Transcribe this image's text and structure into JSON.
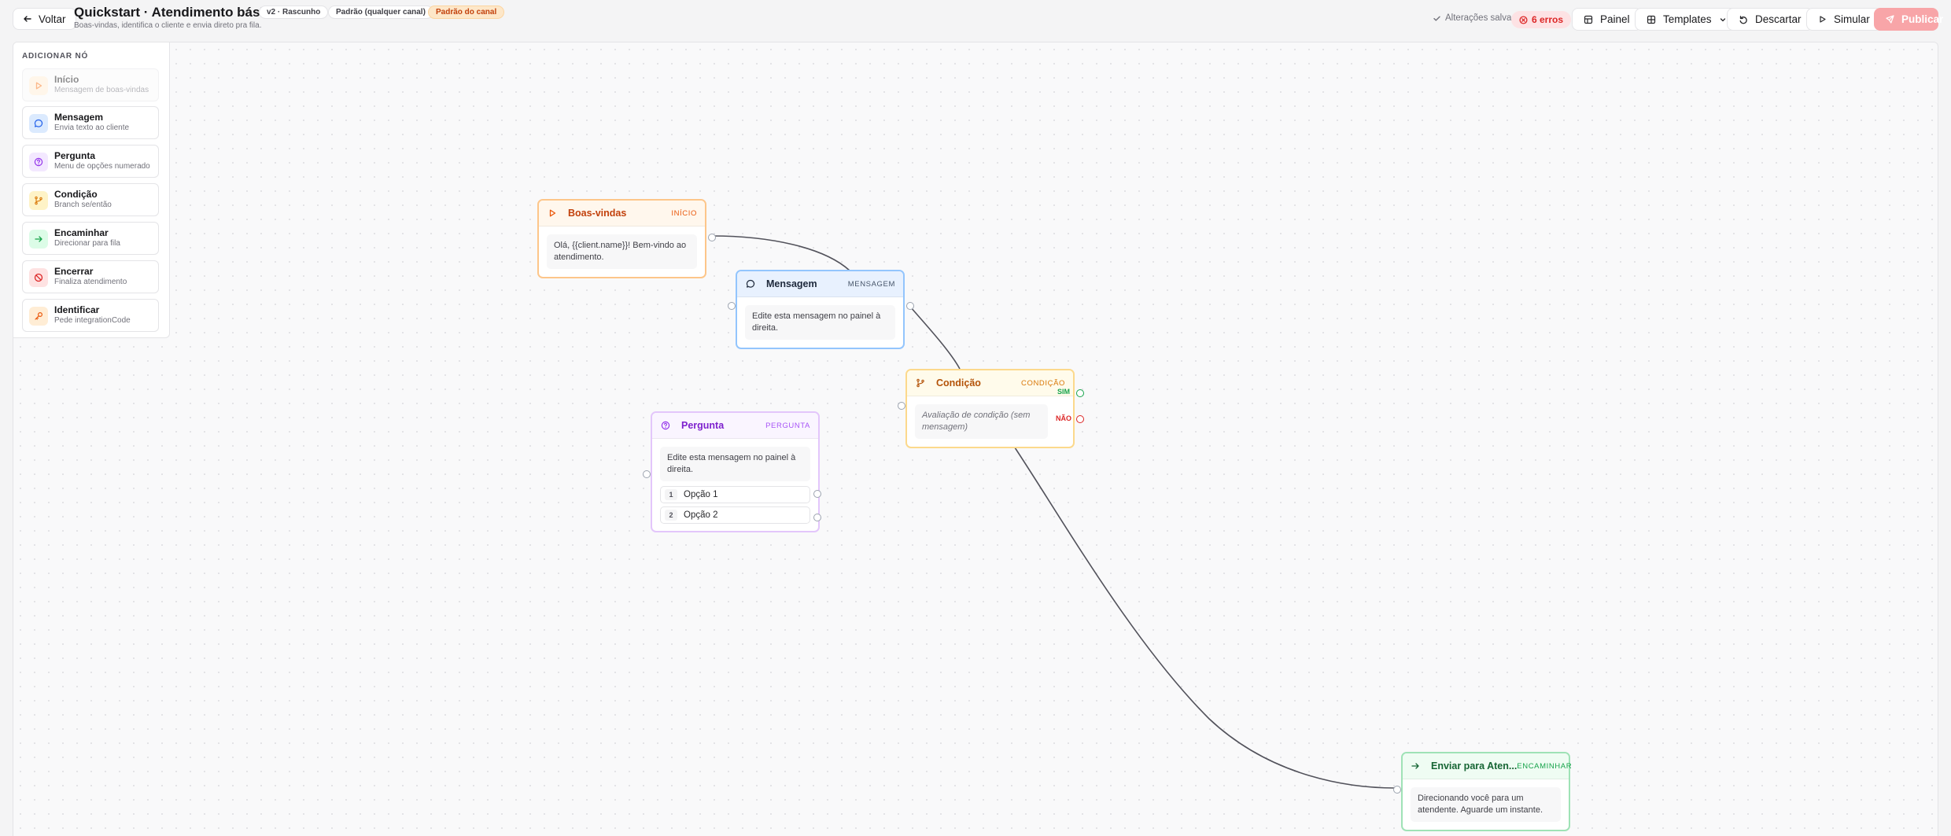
{
  "header": {
    "back_label": "Voltar",
    "title": "Quickstart · Atendimento básico",
    "subtitle": "Boas-vindas, identifica o cliente e envia direto pra fila.",
    "chips": [
      "v2 · Rascunho",
      "Padrão (qualquer canal)",
      "Padrão do canal"
    ],
    "saved_label": "Alterações salvas",
    "errors_label": "6 erros",
    "panel_label": "Painel",
    "templates_label": "Templates",
    "discard_label": "Descartar",
    "simulate_label": "Simular",
    "publish_label": "Publicar"
  },
  "palette": {
    "title": "ADICIONAR NÓ",
    "items": [
      {
        "name": "Início",
        "desc": "Mensagem de boas-vindas",
        "icon": "play-icon",
        "disabled": true
      },
      {
        "name": "Mensagem",
        "desc": "Envia texto ao cliente",
        "icon": "message-icon"
      },
      {
        "name": "Pergunta",
        "desc": "Menu de opções numerado",
        "icon": "question-icon"
      },
      {
        "name": "Condição",
        "desc": "Branch se/então",
        "icon": "branch-icon"
      },
      {
        "name": "Encaminhar",
        "desc": "Direcionar para fila",
        "icon": "arrow-right-icon"
      },
      {
        "name": "Encerrar",
        "desc": "Finaliza atendimento",
        "icon": "ban-icon"
      },
      {
        "name": "Identificar",
        "desc": "Pede integrationCode",
        "icon": "key-icon"
      }
    ]
  },
  "nodes": {
    "boas_vindas": {
      "title": "Boas-vindas",
      "type": "INÍCIO",
      "body": "Olá, {{client.name}}! Bem-vindo ao atendimento."
    },
    "mensagem": {
      "title": "Mensagem",
      "type": "MENSAGEM",
      "body": "Edite esta mensagem no painel à direita."
    },
    "condicao": {
      "title": "Condição",
      "type": "CONDIÇÃO",
      "body": "Avaliação de condição (sem mensagem)",
      "yes_label": "SIM",
      "no_label": "NÃO"
    },
    "pergunta": {
      "title": "Pergunta",
      "type": "PERGUNTA",
      "body": "Edite esta mensagem no painel à direita.",
      "options": [
        {
          "num": "1",
          "label": "Opção 1"
        },
        {
          "num": "2",
          "label": "Opção 2"
        }
      ]
    },
    "encaminhar": {
      "title": "Enviar para Aten...",
      "type": "ENCAMINHAR",
      "body": "Direcionando você para um atendente. Aguarde um instante."
    }
  },
  "colors": {
    "inicio": "#f97316",
    "mensagem": "#3b82f6",
    "pergunta": "#a855f7",
    "condicao": "#f59e0b",
    "encaminhar": "#22c55e",
    "encerrar": "#ef4444",
    "identificar": "#ea580c",
    "error": "#dc2626",
    "publish": "#f8a5a8"
  }
}
